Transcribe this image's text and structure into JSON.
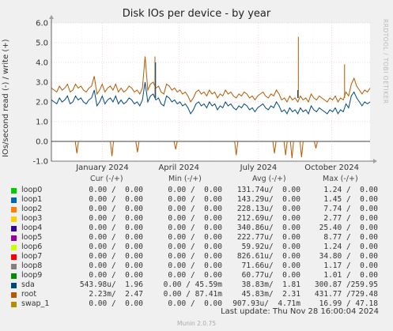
{
  "title": "Disk IOs per device - by year",
  "watermark": "RRDTOOL / TOBI OETIKER",
  "footer": {
    "last_update": "Last update: Thu Nov 28 16:00:04 2024",
    "munin": "Munin 2.0.75"
  },
  "legend_headers": {
    "cur": "Cur (-/+)",
    "min": "Min (-/+)",
    "avg": "Avg (-/+)",
    "max": "Max (-/+)"
  },
  "legend": [
    {
      "name": "loop0",
      "color": "#00cc00",
      "cur": "0.00 /  0.00",
      "min": "0.00 /  0.00",
      "avg": "131.74u/  0.00",
      "max": "1.24 /  0.00"
    },
    {
      "name": "loop1",
      "color": "#0066b3",
      "cur": "0.00 /  0.00",
      "min": "0.00 /  0.00",
      "avg": "143.29u/  0.00",
      "max": "1.45 /  0.00"
    },
    {
      "name": "loop2",
      "color": "#ff8000",
      "cur": "0.00 /  0.00",
      "min": "0.00 /  0.00",
      "avg": "228.13u/  0.00",
      "max": "7.74 /  0.00"
    },
    {
      "name": "loop3",
      "color": "#ffcc00",
      "cur": "0.00 /  0.00",
      "min": "0.00 /  0.00",
      "avg": "212.69u/  0.00",
      "max": "2.77 /  0.00"
    },
    {
      "name": "loop4",
      "color": "#330099",
      "cur": "0.00 /  0.00",
      "min": "0.00 /  0.00",
      "avg": "340.86u/  0.00",
      "max": "25.40 /  0.00"
    },
    {
      "name": "loop5",
      "color": "#990099",
      "cur": "0.00 /  0.00",
      "min": "0.00 /  0.00",
      "avg": "222.77u/  0.00",
      "max": "8.77 /  0.00"
    },
    {
      "name": "loop6",
      "color": "#ccff00",
      "cur": "0.00 /  0.00",
      "min": "0.00 /  0.00",
      "avg": "59.92u/  0.00",
      "max": "1.24 /  0.00"
    },
    {
      "name": "loop7",
      "color": "#ff0000",
      "cur": "0.00 /  0.00",
      "min": "0.00 /  0.00",
      "avg": "826.61u/  0.00",
      "max": "34.80 /  0.00"
    },
    {
      "name": "loop8",
      "color": "#808080",
      "cur": "0.00 /  0.00",
      "min": "0.00 /  0.00",
      "avg": "71.66u/  0.00",
      "max": "1.17 /  0.00"
    },
    {
      "name": "loop9",
      "color": "#008f00",
      "cur": "0.00 /  0.00",
      "min": "0.00 /  0.00",
      "avg": "60.77u/  0.00",
      "max": "1.01 /  0.00"
    },
    {
      "name": "sda",
      "color": "#00487d",
      "cur": "543.98u/  1.96",
      "min": "0.00 / 45.59m",
      "avg": "38.83m/  1.81",
      "max": "300.87 /259.95"
    },
    {
      "name": "root",
      "color": "#b35a00",
      "cur": "2.23m/  2.47",
      "min": "0.00 / 87.41m",
      "avg": "45.83m/  2.31",
      "max": "431.77 /729.48"
    },
    {
      "name": "swap_1",
      "color": "#b38f00",
      "cur": "0.00 /  0.00",
      "min": "0.00 /  0.00",
      "avg": "907.93u/  4.71m",
      "max": "16.99 / 47.18"
    }
  ],
  "chart_data": {
    "type": "line",
    "title": "Disk IOs per device - by year",
    "ylabel": "IOs/second read (-) / write (+)",
    "ylim": [
      -1.0,
      6.0
    ],
    "y_ticks": [
      -1.0,
      0.0,
      1.0,
      2.0,
      3.0,
      4.0,
      5.0,
      6.0
    ],
    "y_tick_labels": [
      "-1.0",
      "0.0",
      "1.0",
      "2.0",
      "3.0",
      "4.0",
      "5.0",
      "6.0"
    ],
    "x_tick_labels": [
      "January 2024",
      "April 2024",
      "July 2024",
      "October 2024"
    ],
    "x_tick_positions": [
      0.16,
      0.4,
      0.65,
      0.88
    ],
    "grid": true,
    "series": [
      {
        "name": "root",
        "color": "#b35a00",
        "values": [
          2.7,
          2.6,
          2.5,
          2.8,
          2.6,
          2.7,
          2.9,
          2.5,
          2.6,
          2.9,
          2.7,
          2.8,
          2.6,
          2.5,
          2.7,
          2.8,
          3.3,
          2.4,
          2.6,
          2.9,
          2.5,
          2.7,
          2.8,
          2.6,
          2.9,
          2.5,
          2.7,
          2.5,
          2.6,
          2.8,
          2.7,
          2.5,
          2.6,
          2.4,
          2.7,
          4.3,
          2.6,
          2.9,
          3.0,
          2.7,
          2.8,
          2.5,
          2.4,
          2.9,
          2.8,
          2.6,
          2.7,
          2.5,
          2.6,
          2.4,
          2.5,
          2.3,
          2.0,
          2.2,
          2.5,
          2.6,
          2.4,
          2.5,
          2.3,
          2.6,
          2.4,
          2.5,
          2.2,
          2.4,
          2.3,
          2.6,
          2.4,
          2.5,
          2.3,
          2.2,
          2.4,
          2.3,
          2.5,
          2.4,
          2.2,
          2.3,
          2.1,
          2.3,
          2.4,
          2.5,
          2.3,
          2.2,
          2.4,
          2.3,
          2.6,
          2.4,
          2.1,
          2.2,
          2.0,
          2.3,
          2.1,
          2.2,
          2.0,
          2.3,
          2.1,
          2.2,
          2.0,
          2.4,
          2.2,
          2.1,
          2.3,
          2.2,
          2.1,
          2.0,
          2.2,
          2.1,
          2.3,
          2.0,
          2.2,
          2.1,
          2.5,
          2.3,
          2.9,
          3.2,
          2.8,
          2.6,
          2.4,
          2.6,
          2.5,
          2.7
        ]
      },
      {
        "name": "sda",
        "color": "#00487d",
        "values": [
          2.1,
          2.0,
          1.9,
          2.2,
          2.0,
          2.1,
          2.3,
          1.9,
          2.0,
          2.3,
          2.1,
          2.2,
          2.0,
          1.9,
          2.1,
          2.2,
          2.6,
          1.8,
          2.0,
          2.3,
          1.9,
          2.1,
          2.2,
          2.0,
          2.3,
          1.9,
          2.1,
          1.9,
          2.0,
          2.2,
          2.1,
          1.9,
          2.0,
          1.8,
          2.1,
          3.0,
          2.0,
          2.3,
          2.4,
          2.1,
          2.2,
          1.9,
          1.8,
          2.3,
          2.2,
          2.0,
          2.1,
          1.9,
          2.0,
          1.8,
          1.9,
          1.7,
          1.4,
          1.6,
          1.9,
          2.0,
          1.8,
          1.9,
          1.7,
          2.0,
          1.8,
          1.9,
          1.6,
          1.8,
          1.7,
          2.0,
          1.8,
          1.9,
          1.7,
          1.6,
          1.8,
          1.7,
          1.9,
          1.8,
          1.6,
          1.7,
          1.5,
          1.7,
          1.8,
          1.9,
          1.7,
          1.6,
          1.8,
          1.7,
          2.0,
          1.8,
          1.5,
          1.6,
          1.4,
          1.7,
          1.5,
          1.6,
          1.4,
          1.7,
          1.5,
          1.6,
          1.4,
          1.8,
          1.6,
          1.5,
          1.7,
          1.6,
          1.5,
          1.4,
          1.6,
          1.5,
          1.7,
          1.4,
          1.6,
          1.5,
          1.9,
          1.7,
          2.3,
          2.5,
          2.2,
          2.0,
          1.8,
          2.0,
          1.9,
          2.0
        ]
      }
    ]
  }
}
